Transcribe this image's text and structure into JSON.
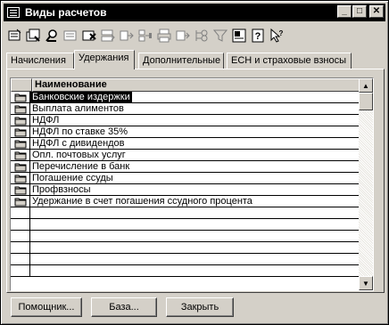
{
  "window": {
    "title": "Виды расчетов",
    "minimize_glyph": "_",
    "maximize_glyph": "□",
    "close_glyph": "✕"
  },
  "toolbar": {
    "tools": [
      "new-icon",
      "copy-icon",
      "find-icon",
      "edit-icon",
      "delete-icon",
      "move-icon",
      "move-level-icon",
      "move-group-icon",
      "print-icon",
      "list-move-icon",
      "hierarchy-icon",
      "filter-icon",
      "settings-icon",
      "help-icon",
      "context-help-icon"
    ]
  },
  "tabs": [
    {
      "label": "Начисления",
      "active": false
    },
    {
      "label": "Удержания",
      "active": true
    },
    {
      "label": "Дополнительные",
      "active": false
    },
    {
      "label": "ЕСН и страховые взносы",
      "active": false
    }
  ],
  "grid": {
    "column_header": "Наименование",
    "rows": [
      "Банковские издержки",
      "Выплата алиментов",
      "НДФЛ",
      "НДФЛ по ставке 35%",
      "НДФЛ с дивидендов",
      "Опл. почтовых услуг",
      "Перечисление в банк",
      "Погашение ссуды",
      "Профвзносы",
      "Удержание в счет погашения ссудного процента"
    ],
    "selected_row": 0
  },
  "buttons": {
    "assistant": "Помощник...",
    "base": "База...",
    "close": "Закрыть"
  }
}
